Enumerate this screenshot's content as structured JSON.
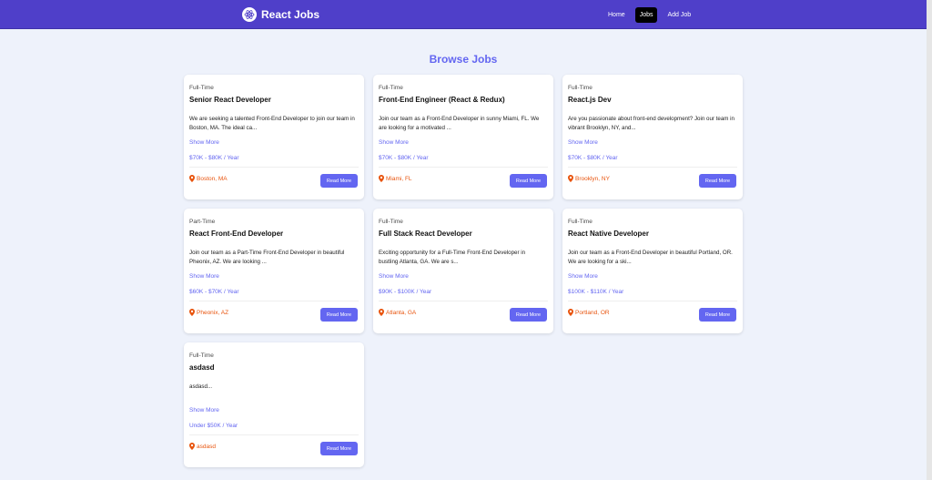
{
  "nav": {
    "brand": "React Jobs",
    "links": [
      "Home",
      "Jobs",
      "Add Job"
    ],
    "active": "Jobs"
  },
  "page": {
    "title": "Browse Jobs"
  },
  "card_labels": {
    "show_more": "Show More",
    "read_more": "Read More"
  },
  "colors": {
    "nav_bg": "#4f3fc9",
    "accent": "#6366f1",
    "location": "#e8550f"
  },
  "jobs": [
    {
      "type": "Full-Time",
      "title": "Senior React Developer",
      "desc": "We are seeking a talented Front-End Developer to join our team in Boston, MA. The ideal ca...",
      "salary": "$70K - $80K / Year",
      "location": "Boston, MA"
    },
    {
      "type": "Full-Time",
      "title": "Front-End Engineer (React & Redux)",
      "desc": "Join our team as a Front-End Developer in sunny Miami, FL. We are looking for a motivated ...",
      "salary": "$70K - $80K / Year",
      "location": "Miami, FL"
    },
    {
      "type": "Full-Time",
      "title": "React.js Dev",
      "desc": "Are you passionate about front-end development? Join our team in vibrant Brooklyn, NY, and...",
      "salary": "$70K - $80K / Year",
      "location": "Brooklyn, NY"
    },
    {
      "type": "Part-Time",
      "title": "React Front-End Developer",
      "desc": "Join our team as a Part-Time Front-End Developer in beautiful Pheonix, AZ. We are looking ...",
      "salary": "$60K - $70K / Year",
      "location": "Pheonix, AZ"
    },
    {
      "type": "Full-Time",
      "title": "Full Stack React Developer",
      "desc": "Exciting opportunity for a Full-Time Front-End Developer in bustling Atlanta, GA. We are s...",
      "salary": "$90K - $100K / Year",
      "location": "Atlanta, GA"
    },
    {
      "type": "Full-Time",
      "title": "React Native Developer",
      "desc": "Join our team as a Front-End Developer in beautiful Portland, OR. We are looking for a ski...",
      "salary": "$100K - $110K / Year",
      "location": "Portland, OR"
    },
    {
      "type": "Full-Time",
      "title": "asdasd",
      "desc": "asdasd...",
      "salary": "Under $50K / Year",
      "location": "asdasd"
    }
  ]
}
